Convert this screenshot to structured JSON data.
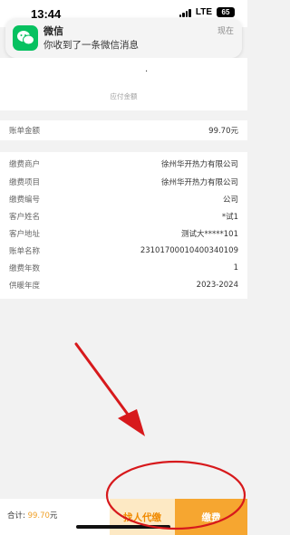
{
  "status_bar": {
    "time": "13:44",
    "network": "LTE",
    "battery": "65"
  },
  "notification": {
    "app": "微信",
    "message": "你收到了一条微信消息",
    "time": "现在",
    "icon": "wechat-icon"
  },
  "header": {
    "amount_dot": "·",
    "amount_label": "应付金额"
  },
  "bill": {
    "label": "账单金额",
    "value": "99.70元"
  },
  "details": [
    {
      "label": "缴费商户",
      "value": "徐州华开热力有限公司"
    },
    {
      "label": "缴费项目",
      "value": "徐州华开热力有限公司"
    },
    {
      "label": "缴费编号",
      "value": "公司"
    },
    {
      "label": "客户姓名",
      "value": "*试1"
    },
    {
      "label": "客户地址",
      "value": "测试大*****101"
    },
    {
      "label": "账单名称",
      "value": "23101700010400340109"
    },
    {
      "label": "缴费年数",
      "value": "1"
    },
    {
      "label": "供暖年度",
      "value": "2023-2024"
    }
  ],
  "bottom": {
    "total_label": "合计:",
    "total_amount": "99.70",
    "total_unit": "元",
    "proxy_button": "找人代缴",
    "pay_button": "缴费"
  },
  "colors": {
    "accent": "#f6a630",
    "proxy_bg": "#fde9c4",
    "proxy_text": "#f08a00",
    "annotation": "#d7191c",
    "wechat": "#07c160"
  }
}
